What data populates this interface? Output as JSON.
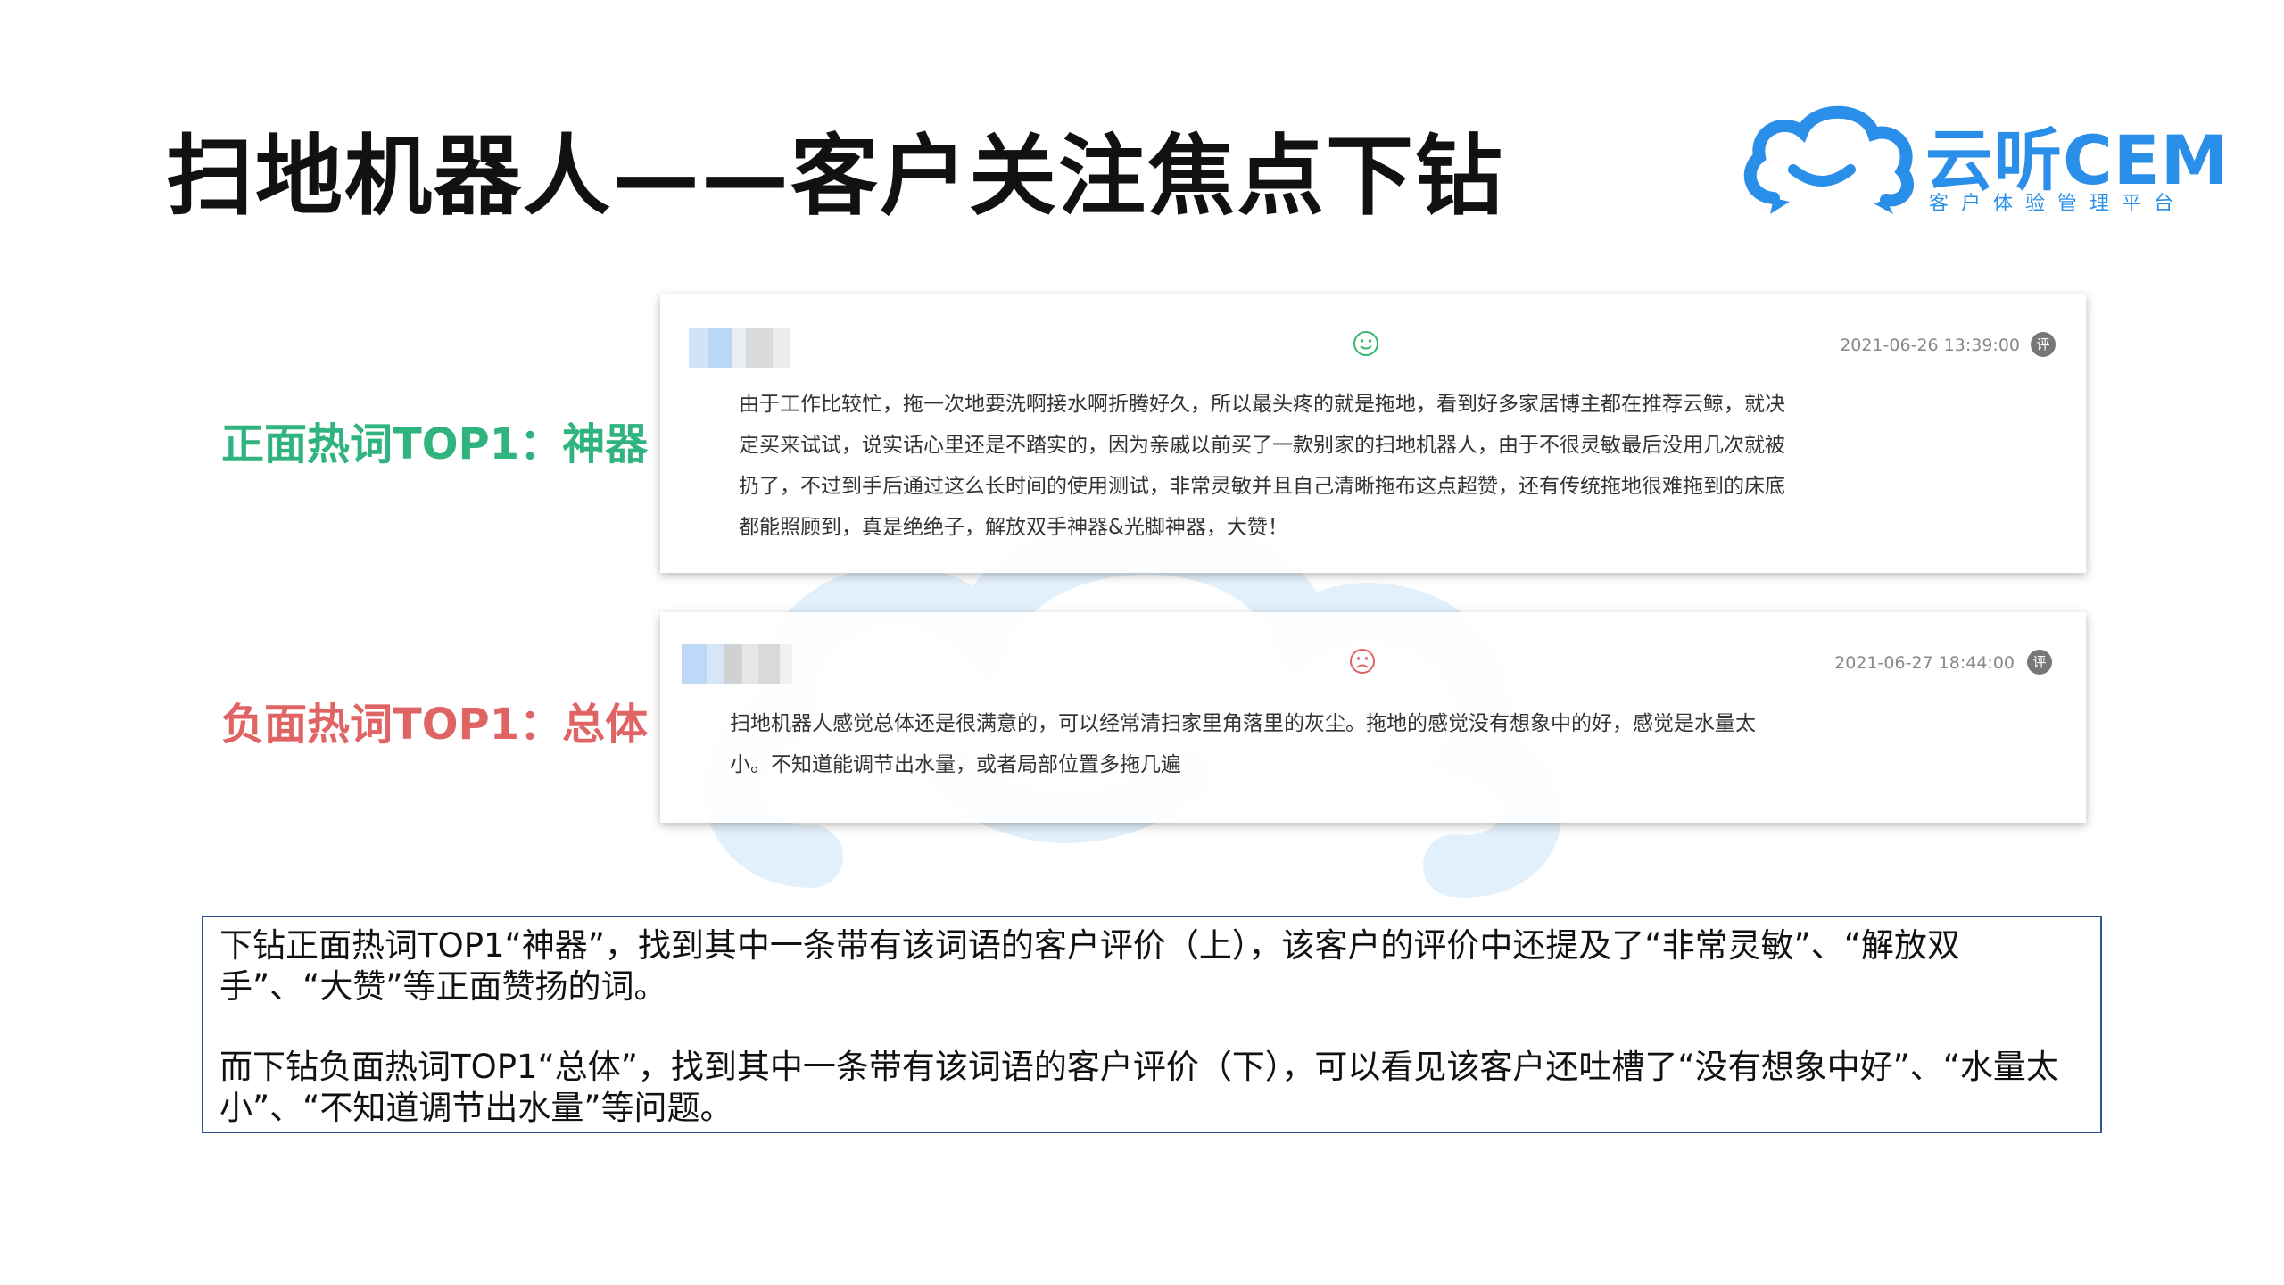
{
  "title": "扫地机器人——客户关注焦点下钻",
  "logo": {
    "name": "云听CEM",
    "tagline": "客户体验管理平台",
    "icon": "cloud-chat-icon",
    "color": "#2a8fe8"
  },
  "labels": {
    "positive": "正面热词TOP1：神器",
    "negative": "负面热词TOP1：总体",
    "positive_color": "#2fb37f",
    "negative_color": "#e06464"
  },
  "reviews": [
    {
      "sentiment": "positive",
      "sentiment_icon": "smile-icon",
      "date": "2021-06-26 13:39:00",
      "badge": "评",
      "text": "由于工作比较忙，拖一次地要洗啊接水啊折腾好久，所以最头疼的就是拖地，看到好多家居博主都在推荐云鲸，就决定买来试试，说实话心里还是不踏实的，因为亲戚以前买了一款别家的扫地机器人，由于不很灵敏最后没用几次就被扔了，不过到手后通过这么长时间的使用测试，非常灵敏并且自己清晰拖布这点超赞，还有传统拖地很难拖到的床底都能照顾到，真是绝绝子，解放双手神器&光脚神器，大赞！"
    },
    {
      "sentiment": "negative",
      "sentiment_icon": "frown-icon",
      "date": "2021-06-27 18:44:00",
      "badge": "评",
      "text": "扫地机器人感觉总体还是很满意的，可以经常清扫家里角落里的灰尘。拖地的感觉没有想象中的好，感觉是水量太小。不知道能调节出水量，或者局部位置多拖几遍"
    }
  ],
  "summary": {
    "paragraph1": "下钻正面热词TOP1“神器”，找到其中一条带有该词语的客户评价（上），该客户的评价中还提及了“非常灵敏”、“解放双手”、“大赞”等正面赞扬的词。",
    "paragraph2": "而下钻负面热词TOP1“总体”，找到其中一条带有该词语的客户评价（下），可以看见该客户还吐槽了“没有想象中好”、“水量太小”、“不知道调节出水量”等问题。"
  }
}
